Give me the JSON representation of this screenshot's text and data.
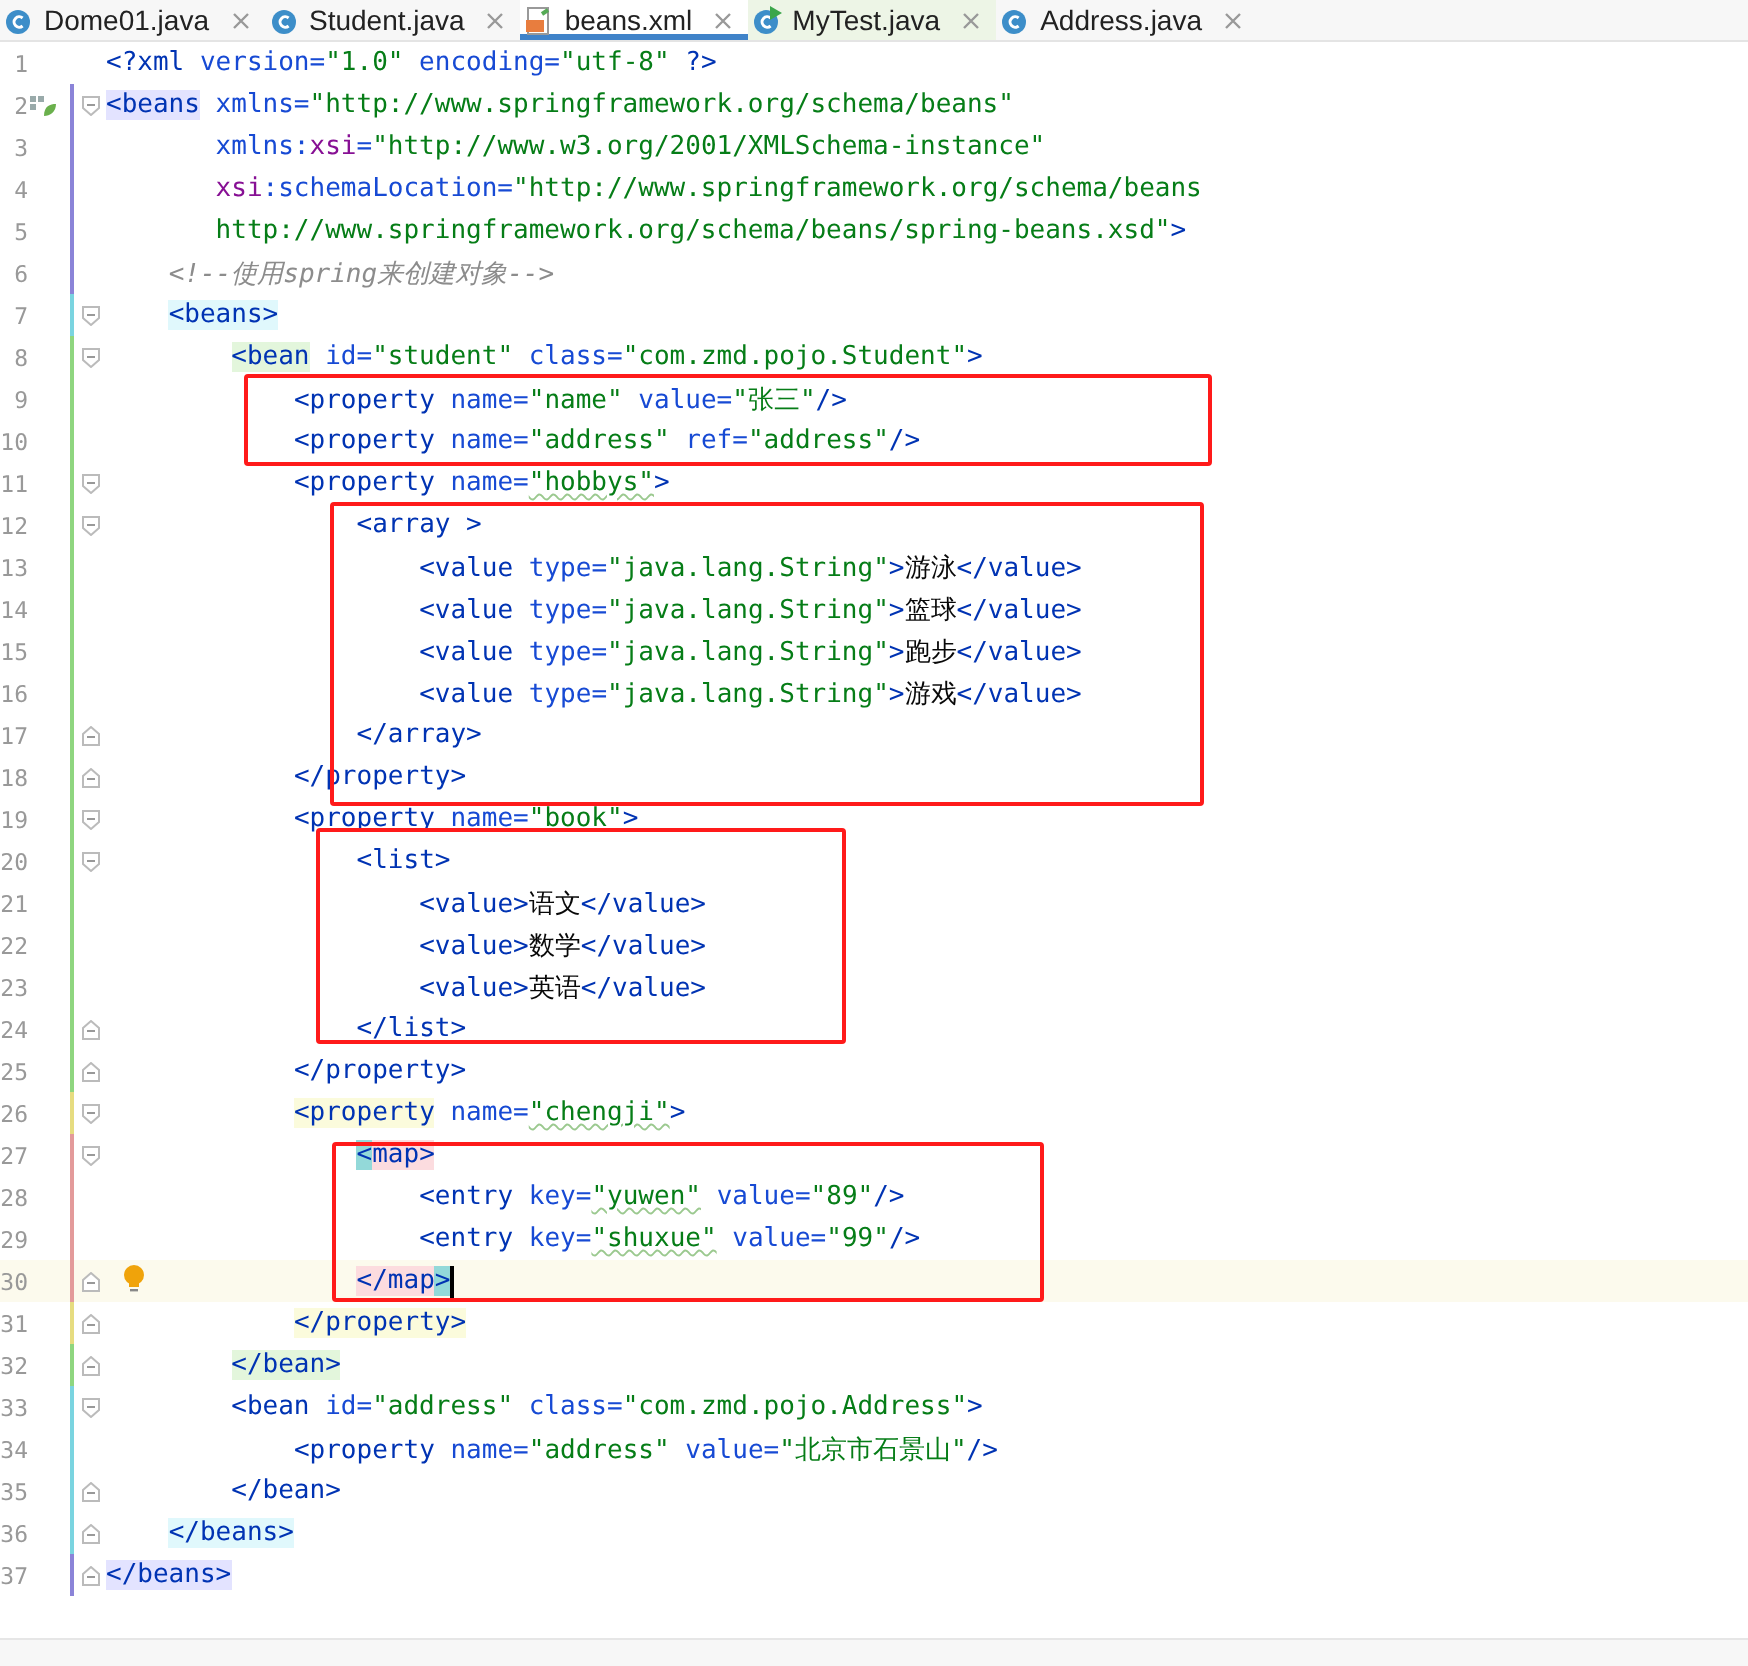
{
  "tabs": [
    {
      "label": "Dome01.java",
      "kind": "class",
      "selected": false
    },
    {
      "label": "Student.java",
      "kind": "class",
      "selected": false
    },
    {
      "label": "beans.xml",
      "kind": "xml",
      "selected": true
    },
    {
      "label": "MyTest.java",
      "kind": "test",
      "selected": false
    },
    {
      "label": "Address.java",
      "kind": "class",
      "selected": false
    }
  ],
  "lines": [
    {
      "number": "1",
      "current": false,
      "fold_start": false,
      "fold_end": false,
      "tokens": [
        {
          "kind": "tag",
          "text": "<?xml"
        },
        {
          "kind": "attr",
          "text": " version="
        },
        {
          "kind": "str",
          "text": "\"1.0\""
        },
        {
          "kind": "attr",
          "text": " encoding="
        },
        {
          "kind": "str",
          "text": "\"utf-8\""
        },
        {
          "kind": "tag",
          "text": " ?>"
        }
      ]
    },
    {
      "number": "2",
      "current": false,
      "color": "#8b84d8",
      "fold_start": true,
      "fold_end": false,
      "icon": {
        "kind": "bean"
      },
      "tokens": [
        {
          "kind": "tag",
          "text": "<beans",
          "color": "#e3e3ff"
        },
        {
          "kind": "attr",
          "text": " xmlns="
        },
        {
          "kind": "str",
          "text": "\"http://www.springframework.org/schema/beans\""
        }
      ]
    },
    {
      "number": "3",
      "current": false,
      "color": "#8b84d8",
      "fold_start": false,
      "fold_end": false,
      "tokens": [
        {
          "kind": "attr",
          "text": "xmlns:"
        },
        {
          "kind": "ns",
          "text": "xsi"
        },
        {
          "kind": "attr",
          "text": "="
        },
        {
          "kind": "str",
          "text": "\"http://www.w3.org/2001/XMLSchema-instance\""
        }
      ]
    },
    {
      "number": "4",
      "current": false,
      "color": "#8b84d8",
      "fold_start": false,
      "fold_end": false,
      "tokens": [
        {
          "kind": "ns",
          "text": "xsi"
        },
        {
          "kind": "attr",
          "text": ":schemaLocation="
        },
        {
          "kind": "str",
          "text": "\"http://www.springframework.org/schema/beans"
        }
      ]
    },
    {
      "number": "5",
      "current": false,
      "color": "#8b84d8",
      "fold_start": false,
      "fold_end": false,
      "tokens": [
        {
          "kind": "str",
          "text": "http://www.springframework.org/schema/beans/spring-beans.xsd\""
        },
        {
          "kind": "tag",
          "text": ">"
        }
      ]
    },
    {
      "number": "6",
      "current": false,
      "color": "#8b84d8",
      "fold_start": false,
      "fold_end": false,
      "tokens": [
        {
          "kind": "comment",
          "text": "<!--使用spring来创建对象-->"
        }
      ]
    },
    {
      "number": "7",
      "current": false,
      "color": "#7ad4e0",
      "fold_start": true,
      "fold_end": false,
      "tokens": [
        {
          "kind": "tag",
          "text": "<beans>",
          "color": "#e0f8fc"
        }
      ]
    },
    {
      "number": "8",
      "current": false,
      "color": "#8fd67f",
      "fold_start": true,
      "fold_end": false,
      "tokens": [
        {
          "kind": "tag",
          "text": "<bean",
          "color": "#e3f6dc"
        },
        {
          "kind": "attr",
          "text": " id="
        },
        {
          "kind": "str",
          "text": "\"student\""
        },
        {
          "kind": "attr",
          "text": " class="
        },
        {
          "kind": "str",
          "text": "\"com.zmd.pojo.Student\""
        },
        {
          "kind": "tag",
          "text": ">"
        }
      ]
    },
    {
      "number": "9",
      "current": false,
      "color": "#8fd67f",
      "fold_start": false,
      "fold_end": false,
      "tokens": [
        {
          "kind": "tag",
          "text": "<property"
        },
        {
          "kind": "attr",
          "text": " name="
        },
        {
          "kind": "str",
          "text": "\"name\""
        },
        {
          "kind": "attr",
          "text": " value="
        },
        {
          "kind": "str",
          "text": "\"张三\""
        },
        {
          "kind": "tag",
          "text": "/>"
        }
      ]
    },
    {
      "number": "10",
      "current": false,
      "color": "#8fd67f",
      "fold_start": false,
      "fold_end": false,
      "tokens": [
        {
          "kind": "tag",
          "text": "<property"
        },
        {
          "kind": "attr",
          "text": " name="
        },
        {
          "kind": "str",
          "text": "\"address\""
        },
        {
          "kind": "attr",
          "text": " ref="
        },
        {
          "kind": "str",
          "text": "\"address\""
        },
        {
          "kind": "tag",
          "text": "/>"
        }
      ]
    },
    {
      "number": "11",
      "current": false,
      "color": "#8fd67f",
      "fold_start": true,
      "fold_end": false,
      "tokens": [
        {
          "kind": "tag",
          "text": "<property"
        },
        {
          "kind": "attr",
          "text": " name="
        },
        {
          "kind": "typo",
          "text": "\"hobbys\""
        },
        {
          "kind": "tag",
          "text": ">"
        }
      ]
    },
    {
      "number": "12",
      "current": false,
      "color": "#8fd67f",
      "fold_start": true,
      "fold_end": false,
      "tokens": [
        {
          "kind": "tag",
          "text": "<array >"
        }
      ]
    },
    {
      "number": "13",
      "current": false,
      "color": "#8fd67f",
      "fold_start": false,
      "fold_end": false,
      "tokens": [
        {
          "kind": "tag",
          "text": "<value"
        },
        {
          "kind": "attr",
          "text": " type="
        },
        {
          "kind": "str",
          "text": "\"java.lang.String\""
        },
        {
          "kind": "tag",
          "text": ">"
        },
        {
          "kind": "text",
          "text": "游泳"
        },
        {
          "kind": "tag",
          "text": "</value>"
        }
      ]
    },
    {
      "number": "14",
      "current": false,
      "color": "#8fd67f",
      "fold_start": false,
      "fold_end": false,
      "tokens": [
        {
          "kind": "tag",
          "text": "<value"
        },
        {
          "kind": "attr",
          "text": " type="
        },
        {
          "kind": "str",
          "text": "\"java.lang.String\""
        },
        {
          "kind": "tag",
          "text": ">"
        },
        {
          "kind": "text",
          "text": "篮球"
        },
        {
          "kind": "tag",
          "text": "</value>"
        }
      ]
    },
    {
      "number": "15",
      "current": false,
      "color": "#8fd67f",
      "fold_start": false,
      "fold_end": false,
      "tokens": [
        {
          "kind": "tag",
          "text": "<value"
        },
        {
          "kind": "attr",
          "text": " type="
        },
        {
          "kind": "str",
          "text": "\"java.lang.String\""
        },
        {
          "kind": "tag",
          "text": ">"
        },
        {
          "kind": "text",
          "text": "跑步"
        },
        {
          "kind": "tag",
          "text": "</value>"
        }
      ]
    },
    {
      "number": "16",
      "current": false,
      "color": "#8fd67f",
      "fold_start": false,
      "fold_end": false,
      "tokens": [
        {
          "kind": "tag",
          "text": "<value"
        },
        {
          "kind": "attr",
          "text": " type="
        },
        {
          "kind": "str",
          "text": "\"java.lang.String\""
        },
        {
          "kind": "tag",
          "text": ">"
        },
        {
          "kind": "text",
          "text": "游戏"
        },
        {
          "kind": "tag",
          "text": "</value>"
        }
      ]
    },
    {
      "number": "17",
      "current": false,
      "color": "#8fd67f",
      "fold_start": false,
      "fold_end": true,
      "tokens": [
        {
          "kind": "tag",
          "text": "</array>"
        }
      ]
    },
    {
      "number": "18",
      "current": false,
      "color": "#8fd67f",
      "fold_start": false,
      "fold_end": true,
      "tokens": [
        {
          "kind": "tag",
          "text": "</property>"
        }
      ]
    },
    {
      "number": "19",
      "current": false,
      "color": "#8fd67f",
      "fold_start": true,
      "fold_end": false,
      "tokens": [
        {
          "kind": "tag",
          "text": "<property"
        },
        {
          "kind": "attr",
          "text": " name="
        },
        {
          "kind": "str",
          "text": "\"book\""
        },
        {
          "kind": "tag",
          "text": ">"
        }
      ]
    },
    {
      "number": "20",
      "current": false,
      "color": "#8fd67f",
      "fold_start": true,
      "fold_end": false,
      "tokens": [
        {
          "kind": "tag",
          "text": "<list>"
        }
      ]
    },
    {
      "number": "21",
      "current": false,
      "color": "#8fd67f",
      "fold_start": false,
      "fold_end": false,
      "tokens": [
        {
          "kind": "tag",
          "text": "<value>"
        },
        {
          "kind": "text",
          "text": "语文"
        },
        {
          "kind": "tag",
          "text": "</value>"
        }
      ]
    },
    {
      "number": "22",
      "current": false,
      "color": "#8fd67f",
      "fold_start": false,
      "fold_end": false,
      "tokens": [
        {
          "kind": "tag",
          "text": "<value>"
        },
        {
          "kind": "text",
          "text": "数学"
        },
        {
          "kind": "tag",
          "text": "</value>"
        }
      ]
    },
    {
      "number": "23",
      "current": false,
      "color": "#8fd67f",
      "fold_start": false,
      "fold_end": false,
      "tokens": [
        {
          "kind": "tag",
          "text": "<value>"
        },
        {
          "kind": "text",
          "text": "英语"
        },
        {
          "kind": "tag",
          "text": "</value>"
        }
      ]
    },
    {
      "number": "24",
      "current": false,
      "color": "#8fd67f",
      "fold_start": false,
      "fold_end": true,
      "tokens": [
        {
          "kind": "tag",
          "text": "</list>"
        }
      ]
    },
    {
      "number": "25",
      "current": false,
      "color": "#8fd67f",
      "fold_start": false,
      "fold_end": true,
      "tokens": [
        {
          "kind": "tag",
          "text": "</property>"
        }
      ]
    },
    {
      "number": "26",
      "current": false,
      "color": "#e6dc80",
      "fold_start": true,
      "fold_end": false,
      "tokens": [
        {
          "kind": "tag",
          "text": "<property",
          "color": "#fbfbdc"
        },
        {
          "kind": "attr",
          "text": " name="
        },
        {
          "kind": "typo",
          "text": "\"chengji\""
        },
        {
          "kind": "tag",
          "text": ">"
        }
      ]
    },
    {
      "number": "27",
      "current": false,
      "color": "#e39a9a",
      "fold_start": true,
      "fold_end": false,
      "tokens": [
        {
          "kind": "tag",
          "text": "<",
          "color": "#93d9d9"
        },
        {
          "kind": "tag",
          "text": "map>",
          "color": "#fcdcdf"
        }
      ]
    },
    {
      "number": "28",
      "current": false,
      "color": "#e39a9a",
      "fold_start": false,
      "fold_end": false,
      "tokens": [
        {
          "kind": "tag",
          "text": "<entry"
        },
        {
          "kind": "attr",
          "text": " key="
        },
        {
          "kind": "typo",
          "text": "\"yuwen\""
        },
        {
          "kind": "attr",
          "text": " value="
        },
        {
          "kind": "str",
          "text": "\"89\""
        },
        {
          "kind": "tag",
          "text": "/>"
        }
      ]
    },
    {
      "number": "29",
      "current": false,
      "color": "#e39a9a",
      "fold_start": false,
      "fold_end": false,
      "tokens": [
        {
          "kind": "tag",
          "text": "<entry"
        },
        {
          "kind": "attr",
          "text": " key="
        },
        {
          "kind": "typo",
          "text": "\"shuxue\""
        },
        {
          "kind": "attr",
          "text": " value="
        },
        {
          "kind": "str",
          "text": "\"99\""
        },
        {
          "kind": "tag",
          "text": "/>"
        }
      ]
    },
    {
      "number": "30",
      "current": true,
      "color": "#e39a9a",
      "fold_start": false,
      "fold_end": true,
      "icon": {
        "kind": "bulb"
      },
      "tokens": [
        {
          "kind": "tag",
          "text": "</map",
          "color": "#fcdcdf"
        },
        {
          "kind": "tag",
          "text": ">",
          "color": "#93d9d9"
        }
      ]
    },
    {
      "number": "31",
      "current": false,
      "color": "#e6dc80",
      "fold_start": false,
      "fold_end": true,
      "tokens": [
        {
          "kind": "tag",
          "text": "</property>",
          "color": "#fbfbdc"
        }
      ]
    },
    {
      "number": "32",
      "current": false,
      "color": "#8fd67f",
      "fold_start": false,
      "fold_end": true,
      "tokens": [
        {
          "kind": "tag",
          "text": "</bean>",
          "color": "#e3f6dc"
        }
      ]
    },
    {
      "number": "33",
      "current": false,
      "color": "#7ad4e0",
      "fold_start": true,
      "fold_end": false,
      "tokens": [
        {
          "kind": "tag",
          "text": "<bean"
        },
        {
          "kind": "attr",
          "text": " id="
        },
        {
          "kind": "str",
          "text": "\"address\""
        },
        {
          "kind": "attr",
          "text": " class="
        },
        {
          "kind": "str",
          "text": "\"com.zmd.pojo.Address\""
        },
        {
          "kind": "tag",
          "text": ">"
        }
      ]
    },
    {
      "number": "34",
      "current": false,
      "color": "#7ad4e0",
      "fold_start": false,
      "fold_end": false,
      "tokens": [
        {
          "kind": "tag",
          "text": "<property"
        },
        {
          "kind": "attr",
          "text": " name="
        },
        {
          "kind": "str",
          "text": "\"address\""
        },
        {
          "kind": "attr",
          "text": " value="
        },
        {
          "kind": "str",
          "text": "\"北京市石景山\""
        },
        {
          "kind": "tag",
          "text": "/>"
        }
      ]
    },
    {
      "number": "35",
      "current": false,
      "color": "#7ad4e0",
      "fold_start": false,
      "fold_end": true,
      "tokens": [
        {
          "kind": "tag",
          "text": "</bean>"
        }
      ]
    },
    {
      "number": "36",
      "current": false,
      "color": "#7ad4e0",
      "fold_start": false,
      "fold_end": true,
      "tokens": [
        {
          "kind": "tag",
          "text": "</beans>",
          "color": "#e0f8fc"
        }
      ]
    },
    {
      "number": "37",
      "current": false,
      "color": "#8b84d8",
      "fold_start": false,
      "fold_end": true,
      "tokens": [
        {
          "kind": "tag",
          "text": "</beans>",
          "color": "#e3e3ff"
        }
      ]
    }
  ],
  "annotations": [
    {
      "kind": "rectangle"
    },
    {
      "kind": "rectangle"
    },
    {
      "kind": "rectangle"
    },
    {
      "kind": "rectangle"
    }
  ]
}
